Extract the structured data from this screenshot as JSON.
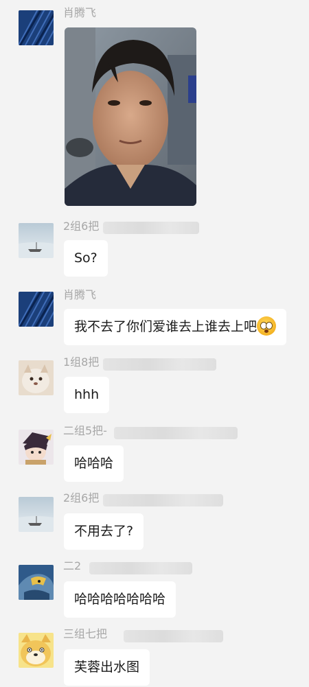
{
  "messages": [
    {
      "name": "肖腾飞",
      "type": "image",
      "image_desc": "selfie-photo"
    },
    {
      "name": "2组6把",
      "type": "text",
      "text": "So?"
    },
    {
      "name": "肖腾飞",
      "type": "text",
      "text": "我不去了你们爱谁去上谁去上吧"
    },
    {
      "name": "1组8把",
      "type": "text",
      "text": "hhh"
    },
    {
      "name": "二组5把-",
      "type": "text",
      "text": "哈哈哈"
    },
    {
      "name": "2组6把",
      "type": "text",
      "text": "不用去了?"
    },
    {
      "name": "二2",
      "type": "text",
      "text": "哈哈哈哈哈哈哈"
    },
    {
      "name": "三组七把",
      "type": "text",
      "text": "芙蓉出水图"
    }
  ],
  "emoji": "flushed-face-emoji"
}
